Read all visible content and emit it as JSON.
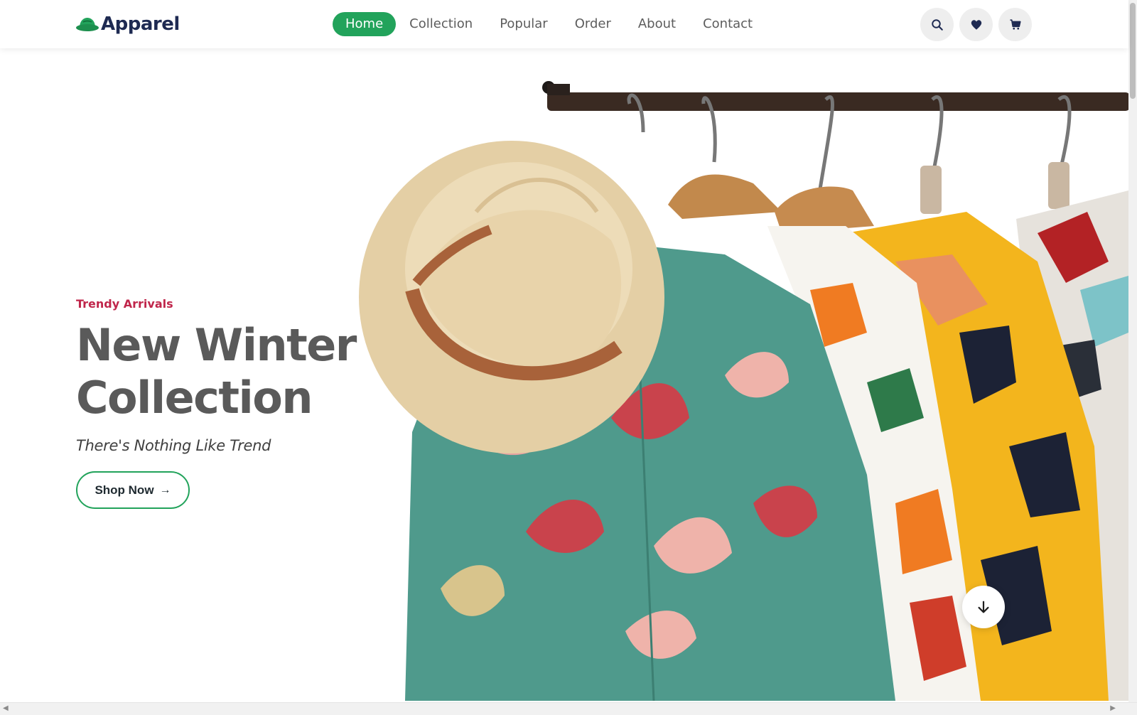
{
  "brand": {
    "name": "Apparel",
    "logo_icon": "hat-icon",
    "accent": "#22a35b",
    "dark": "#1e2a52"
  },
  "nav": {
    "items": [
      {
        "label": "Home",
        "active": true
      },
      {
        "label": "Collection",
        "active": false
      },
      {
        "label": "Popular",
        "active": false
      },
      {
        "label": "Order",
        "active": false
      },
      {
        "label": "About",
        "active": false
      },
      {
        "label": "Contact",
        "active": false
      }
    ]
  },
  "header_icons": [
    "search-icon",
    "heart-icon",
    "cart-icon"
  ],
  "hero": {
    "eyebrow": "Trendy Arrivals",
    "headline_line1": "New Winter",
    "headline_line2": "Collection",
    "tagline": "There's Nothing Like Trend",
    "cta_label": "Shop Now",
    "cta_arrow": "→",
    "eyebrow_color": "#c0264b",
    "scroll_icon": "arrow-down-icon"
  }
}
